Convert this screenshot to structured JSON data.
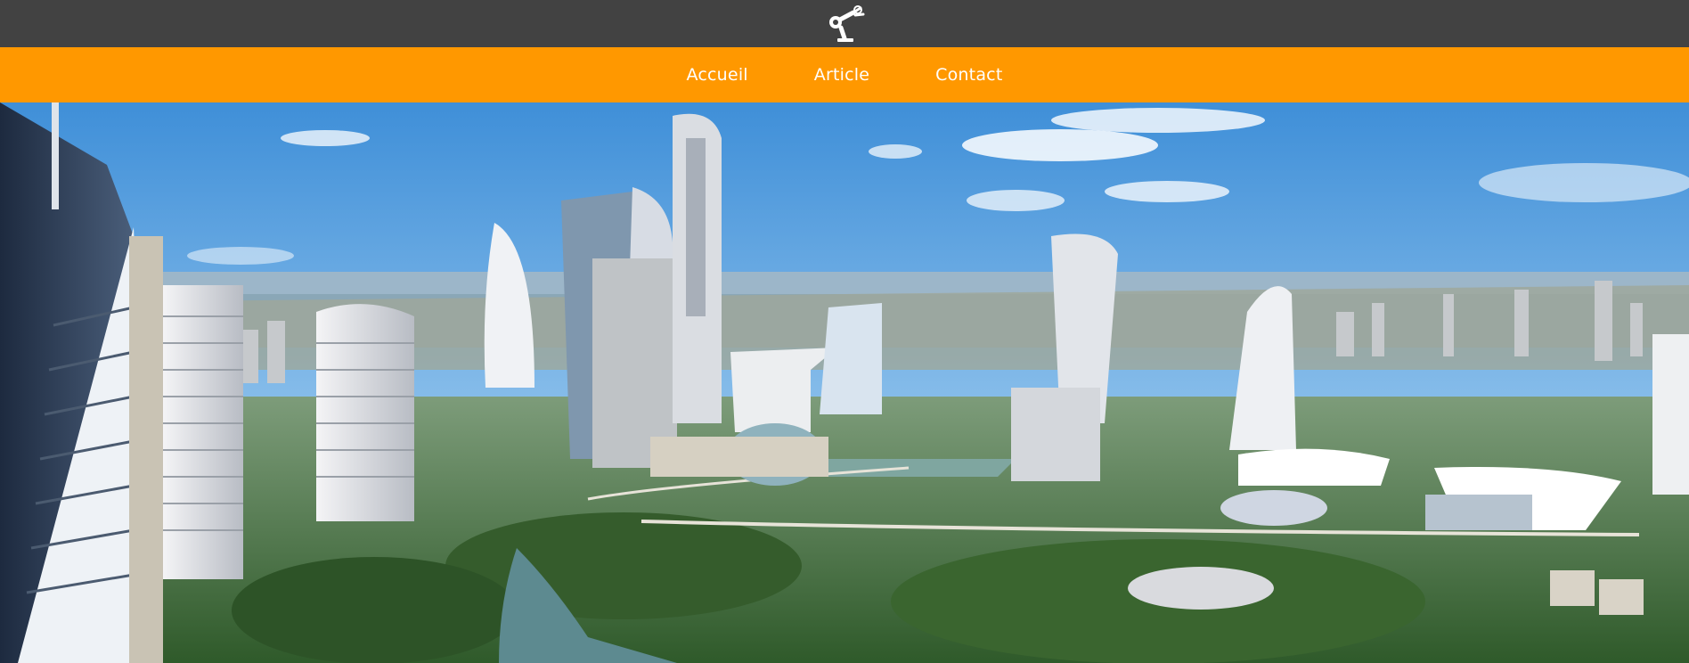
{
  "header": {
    "logo_icon": "robot-arm-icon",
    "background_color": "#424242"
  },
  "nav": {
    "background_color": "#ff9800",
    "items": [
      {
        "label": "Accueil"
      },
      {
        "label": "Article"
      },
      {
        "label": "Contact"
      }
    ]
  },
  "hero": {
    "image": "futuristic-city-skyline-image"
  }
}
